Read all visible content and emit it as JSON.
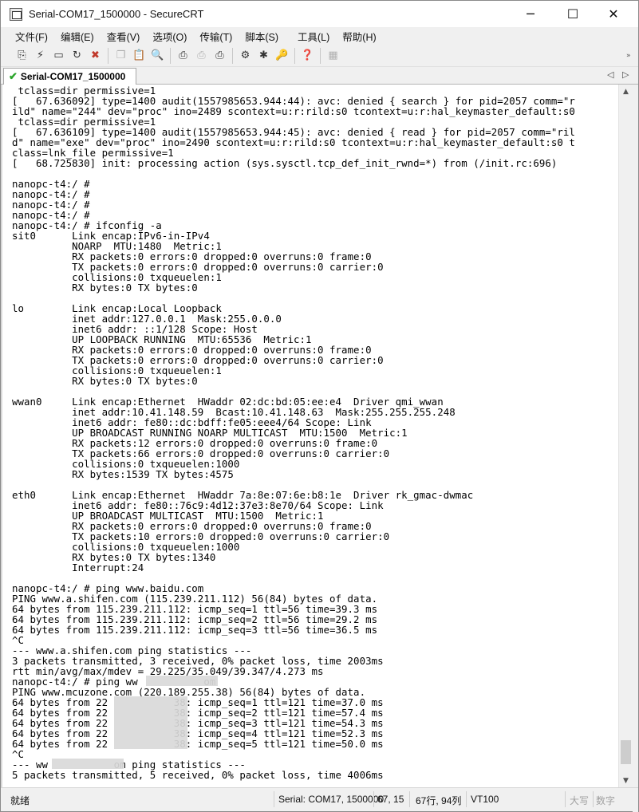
{
  "window": {
    "title": "Serial-COM17_1500000 - SecureCRT",
    "minimize": "─",
    "maximize": "☐",
    "close": "✕"
  },
  "menu": [
    "文件(F)",
    "编辑(E)",
    "查看(V)",
    "选项(O)",
    "传输(T)",
    "脚本(S)",
    "工具(L)",
    "帮助(H)"
  ],
  "toolbar": {
    "icons": [
      "connect-icon",
      "quick-connect-icon",
      "connect-in-tab-icon",
      "reconnect-icon",
      "disconnect-icon",
      "copy-icon",
      "paste-icon",
      "find-icon",
      "print-icon",
      "print-selection-icon",
      "print-setup-icon",
      "session-options-icon",
      "global-options-icon",
      "keymap-icon",
      "help-icon",
      "map-icon"
    ],
    "overflow": "»"
  },
  "tab": {
    "label": "Serial-COM17_1500000",
    "prev": "◁",
    "next": "▷"
  },
  "terminal": {
    "lines": [
      " tclass=dir permissive=1",
      "[   67.636092] type=1400 audit(1557985653.944:44): avc: denied { search } for pid=2057 comm=\"r",
      "ild\" name=\"244\" dev=\"proc\" ino=2489 scontext=u:r:rild:s0 tcontext=u:r:hal_keymaster_default:s0",
      " tclass=dir permissive=1",
      "[   67.636109] type=1400 audit(1557985653.944:45): avc: denied { read } for pid=2057 comm=\"ril",
      "d\" name=\"exe\" dev=\"proc\" ino=2490 scontext=u:r:rild:s0 tcontext=u:r:hal_keymaster_default:s0 t",
      "class=lnk_file permissive=1",
      "[   68.725830] init: processing action (sys.sysctl.tcp_def_init_rwnd=*) from (/init.rc:696)",
      "",
      "nanopc-t4:/ #",
      "nanopc-t4:/ #",
      "nanopc-t4:/ #",
      "nanopc-t4:/ #",
      "nanopc-t4:/ # ifconfig -a",
      "sit0      Link encap:IPv6-in-IPv4",
      "          NOARP  MTU:1480  Metric:1",
      "          RX packets:0 errors:0 dropped:0 overruns:0 frame:0",
      "          TX packets:0 errors:0 dropped:0 overruns:0 carrier:0",
      "          collisions:0 txqueuelen:1",
      "          RX bytes:0 TX bytes:0",
      "",
      "lo        Link encap:Local Loopback",
      "          inet addr:127.0.0.1  Mask:255.0.0.0",
      "          inet6 addr: ::1/128 Scope: Host",
      "          UP LOOPBACK RUNNING  MTU:65536  Metric:1",
      "          RX packets:0 errors:0 dropped:0 overruns:0 frame:0",
      "          TX packets:0 errors:0 dropped:0 overruns:0 carrier:0",
      "          collisions:0 txqueuelen:1",
      "          RX bytes:0 TX bytes:0",
      "",
      "wwan0     Link encap:Ethernet  HWaddr 02:dc:bd:05:ee:e4  Driver qmi_wwan",
      "          inet addr:10.41.148.59  Bcast:10.41.148.63  Mask:255.255.255.248",
      "          inet6 addr: fe80::dc:bdff:fe05:eee4/64 Scope: Link",
      "          UP BROADCAST RUNNING NOARP MULTICAST  MTU:1500  Metric:1",
      "          RX packets:12 errors:0 dropped:0 overruns:0 frame:0",
      "          TX packets:66 errors:0 dropped:0 overruns:0 carrier:0",
      "          collisions:0 txqueuelen:1000",
      "          RX bytes:1539 TX bytes:4575",
      "",
      "eth0      Link encap:Ethernet  HWaddr 7a:8e:07:6e:b8:1e  Driver rk_gmac-dwmac",
      "          inet6 addr: fe80::76c9:4d12:37e3:8e70/64 Scope: Link",
      "          UP BROADCAST MULTICAST  MTU:1500  Metric:1",
      "          RX packets:0 errors:0 dropped:0 overruns:0 frame:0",
      "          TX packets:10 errors:0 dropped:0 overruns:0 carrier:0",
      "          collisions:0 txqueuelen:1000",
      "          RX bytes:0 TX bytes:1340",
      "          Interrupt:24",
      "",
      "nanopc-t4:/ # ping www.baidu.com",
      "PING www.a.shifen.com (115.239.211.112) 56(84) bytes of data.",
      "64 bytes from 115.239.211.112: icmp_seq=1 ttl=56 time=39.3 ms",
      "64 bytes from 115.239.211.112: icmp_seq=2 ttl=56 time=29.2 ms",
      "64 bytes from 115.239.211.112: icmp_seq=3 ttl=56 time=36.5 ms",
      "^C",
      "--- www.a.shifen.com ping statistics ---",
      "3 packets transmitted, 3 received, 0% packet loss, time 2003ms",
      "rtt min/avg/max/mdev = 29.225/35.049/39.347/4.273 ms",
      "nanopc-t4:/ # ping ww           om",
      "PING www.mcuzone.com (220.189.255.38) 56(84) bytes of data.",
      "64 bytes from 22           38: icmp_seq=1 ttl=121 time=37.0 ms",
      "64 bytes from 22           38: icmp_seq=2 ttl=121 time=57.4 ms",
      "64 bytes from 22           38: icmp_seq=3 ttl=121 time=54.3 ms",
      "64 bytes from 22           38: icmp_seq=4 ttl=121 time=52.3 ms",
      "64 bytes from 22           38: icmp_seq=5 ttl=121 time=50.0 ms",
      "^C",
      "--- ww           om ping statistics ---",
      "5 packets transmitted, 5 received, 0% packet loss, time 4006ms"
    ]
  },
  "statusbar": {
    "ready": "就绪",
    "serial": "Serial: COM17, 1500000",
    "pos": "67, 15",
    "rowcol": "67行, 94列",
    "emulation": "VT100",
    "caps": "大写",
    "num": "数字"
  }
}
